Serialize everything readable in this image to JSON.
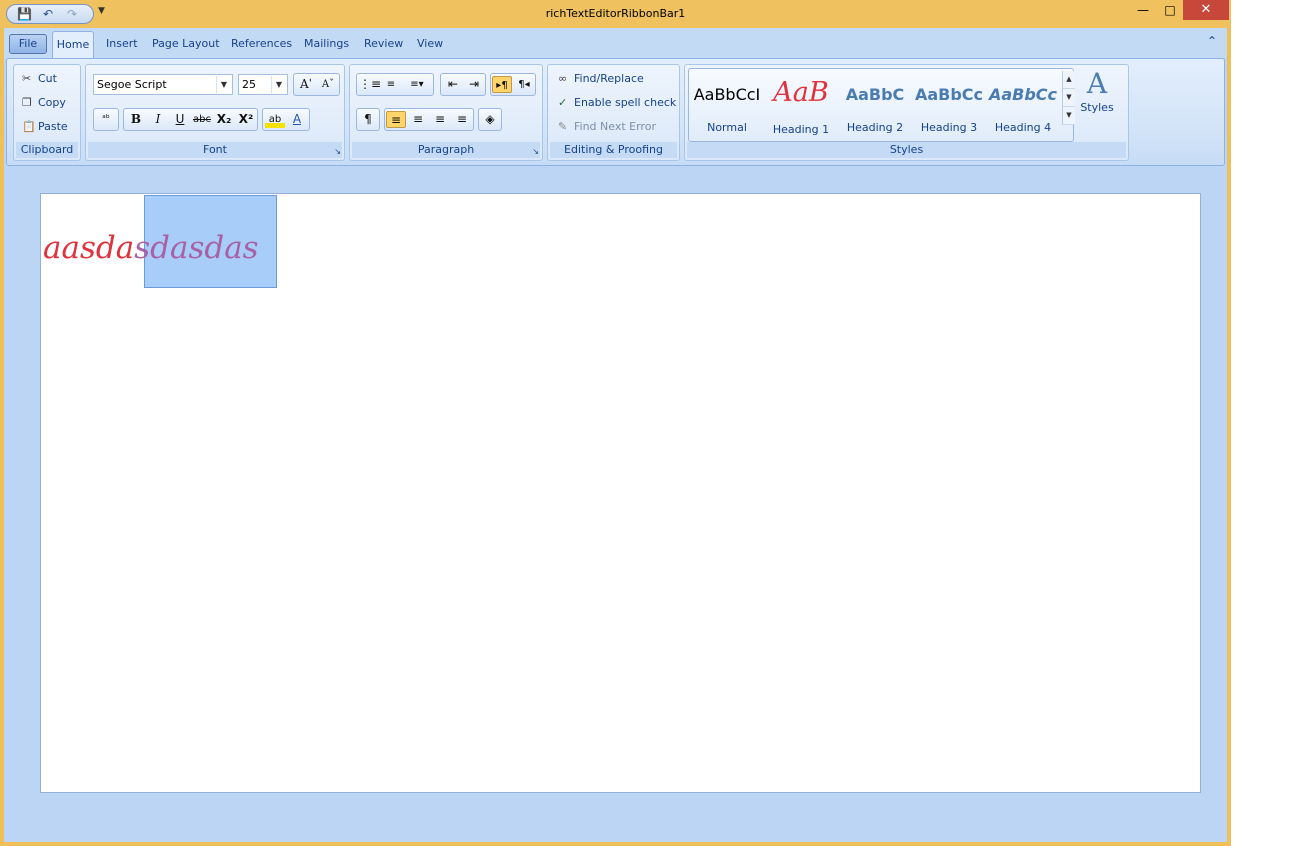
{
  "window": {
    "title": "richTextEditorRibbonBar1"
  },
  "qat": {
    "save_icon": "save-icon",
    "undo_icon": "undo-icon",
    "redo_icon": "redo-icon"
  },
  "tabs": [
    {
      "label": "File"
    },
    {
      "label": "Home"
    },
    {
      "label": "Insert"
    },
    {
      "label": "Page Layout"
    },
    {
      "label": "References"
    },
    {
      "label": "Mailings"
    },
    {
      "label": "Review"
    },
    {
      "label": "View"
    }
  ],
  "clipboard": {
    "title": "Clipboard",
    "cut": "Cut",
    "copy": "Copy",
    "paste": "Paste"
  },
  "font": {
    "title": "Font",
    "family": "Segoe Script",
    "size": "25"
  },
  "paragraph": {
    "title": "Paragraph"
  },
  "editing": {
    "title": "Editing & Proofing",
    "find_replace": "Find/Replace",
    "spell_check": "Enable spell check",
    "find_next_error": "Find Next Error"
  },
  "styles": {
    "title": "Styles",
    "button_label": "Styles",
    "items": [
      {
        "sample": "AaBbCcI",
        "label": "Normal"
      },
      {
        "sample": "AaB",
        "label": "Heading 1"
      },
      {
        "sample": "AaBbC",
        "label": "Heading 2"
      },
      {
        "sample": "AaBbCc",
        "label": "Heading 3"
      },
      {
        "sample": "AaBbCc",
        "label": "Heading 4"
      }
    ]
  },
  "document": {
    "text_plain": "aasda",
    "text_selected": "sdasdas"
  },
  "colors": {
    "title_bar": "#efc25f",
    "client_bg": "#bcd5f5",
    "close_button": "#c7473a",
    "text_red": "#e0323c",
    "text_selected": "#a861a4",
    "selection": "#a8cdf8"
  }
}
